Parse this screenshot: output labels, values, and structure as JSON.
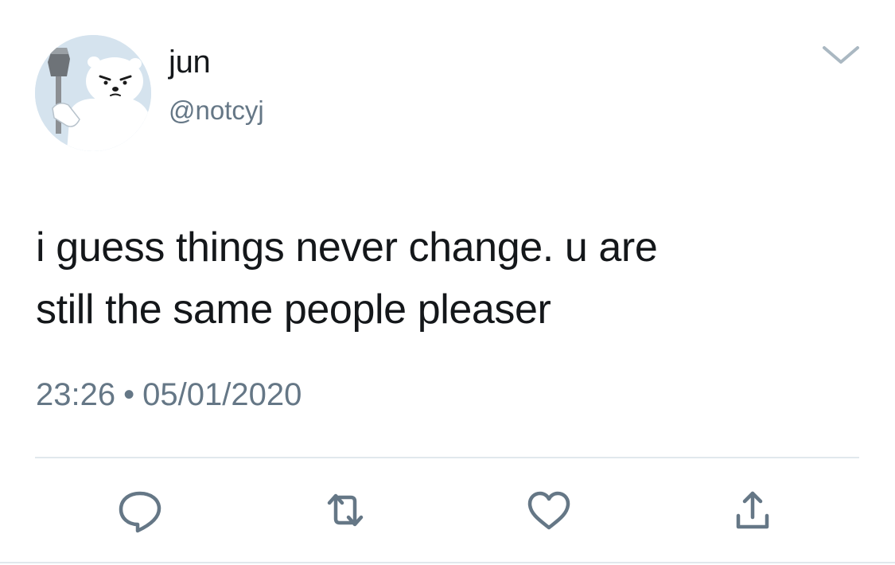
{
  "tweet": {
    "author": {
      "display_name": "jun",
      "handle": "@notcyj",
      "avatar_icon": "polar-bear-avatar"
    },
    "text": "i guess things never change. u are\nstill the same people pleaser",
    "time": "23:26",
    "separator": "•",
    "date": "05/01/2020",
    "menu_icon": "chevron-down-icon",
    "actions": [
      {
        "name": "reply",
        "icon": "reply-icon"
      },
      {
        "name": "retweet",
        "icon": "retweet-icon"
      },
      {
        "name": "like",
        "icon": "heart-icon"
      },
      {
        "name": "share",
        "icon": "share-icon"
      }
    ],
    "colors": {
      "text": "#14171a",
      "secondary": "#657786",
      "icon": "#657786",
      "divider": "#e1e8ed"
    }
  }
}
